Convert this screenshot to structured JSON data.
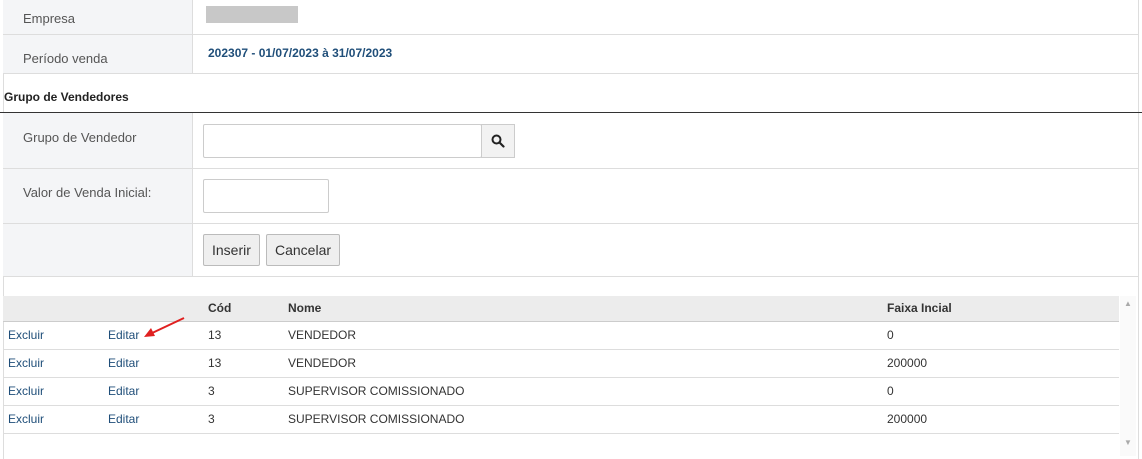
{
  "header": {
    "empresa_label": "Empresa",
    "periodo_label": "Período venda",
    "periodo_value": "202307 - 01/07/2023 à 31/07/2023"
  },
  "section": {
    "title": "Grupo de Vendedores"
  },
  "form": {
    "grupo_label": "Grupo de Vendedor",
    "grupo_value": "",
    "valor_label": "Valor de Venda Inicial:",
    "valor_value": "",
    "inserir_label": "Inserir",
    "cancelar_label": "Cancelar"
  },
  "table": {
    "columns": [
      "",
      "",
      "Cód",
      "Nome",
      "Faixa Incial"
    ],
    "excluir_label": "Excluir",
    "editar_label": "Editar",
    "rows": [
      {
        "excluir": "Excluir",
        "editar": "Editar",
        "cod": "13",
        "nome": "VENDEDOR",
        "faixa": "0"
      },
      {
        "excluir": "Excluir",
        "editar": "Editar",
        "cod": "13",
        "nome": "VENDEDOR",
        "faixa": "200000"
      },
      {
        "excluir": "Excluir",
        "editar": "Editar",
        "cod": "3",
        "nome": "SUPERVISOR COMISSIONADO",
        "faixa": "0"
      },
      {
        "excluir": "Excluir",
        "editar": "Editar",
        "cod": "3",
        "nome": "SUPERVISOR COMISSIONADO",
        "faixa": "200000"
      }
    ]
  },
  "colors": {
    "link": "#1f4e79",
    "label_bg": "#f4f5f7",
    "annotation_arrow": "#e02020"
  }
}
